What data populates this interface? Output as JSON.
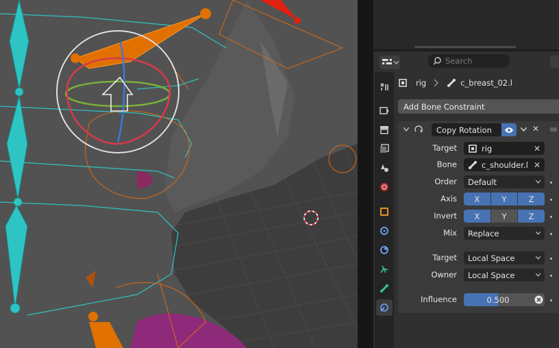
{
  "properties": {
    "search": {
      "placeholder": "Search"
    },
    "breadcrumb": {
      "object": "rig",
      "bone": "c_breast_02.l"
    },
    "add_constraint_label": "Add Bone Constraint",
    "constraint": {
      "name": "Copy Rotation",
      "target_label": "Target",
      "target_value": "rig",
      "bone_label": "Bone",
      "bone_value": "c_shoulder.l",
      "order_label": "Order",
      "order_value": "Default",
      "axis_label": "Axis",
      "axis": [
        {
          "label": "X",
          "on": true
        },
        {
          "label": "Y",
          "on": true
        },
        {
          "label": "Z",
          "on": true
        }
      ],
      "invert_label": "Invert",
      "invert": [
        {
          "label": "X",
          "on": true
        },
        {
          "label": "Y",
          "on": false
        },
        {
          "label": "Z",
          "on": true
        }
      ],
      "mix_label": "Mix",
      "mix_value": "Replace",
      "target_space_label": "Target",
      "target_space_value": "Local Space",
      "owner_space_label": "Owner",
      "owner_space_value": "Local Space",
      "influence_label": "Influence",
      "influence_value": "0.500",
      "influence_fraction": 0.5
    },
    "tabs": [
      "tool-icon",
      "render-icon",
      "output-icon",
      "view-layer-icon",
      "scene-icon",
      "world-icon",
      "object-icon",
      "modifier-icon",
      "physics-icon",
      "object-constraint-icon",
      "bone-icon",
      "bone-constraint-icon"
    ],
    "active_tab": "bone-constraint-icon"
  },
  "colors": {
    "accent": "#4772b3",
    "bone_cyan": "#2fc4c4",
    "bone_orange": "#e07000",
    "gizmo_red": "#d93a4a",
    "gizmo_green": "#7ab03a",
    "gizmo_blue": "#3a7ad9"
  }
}
